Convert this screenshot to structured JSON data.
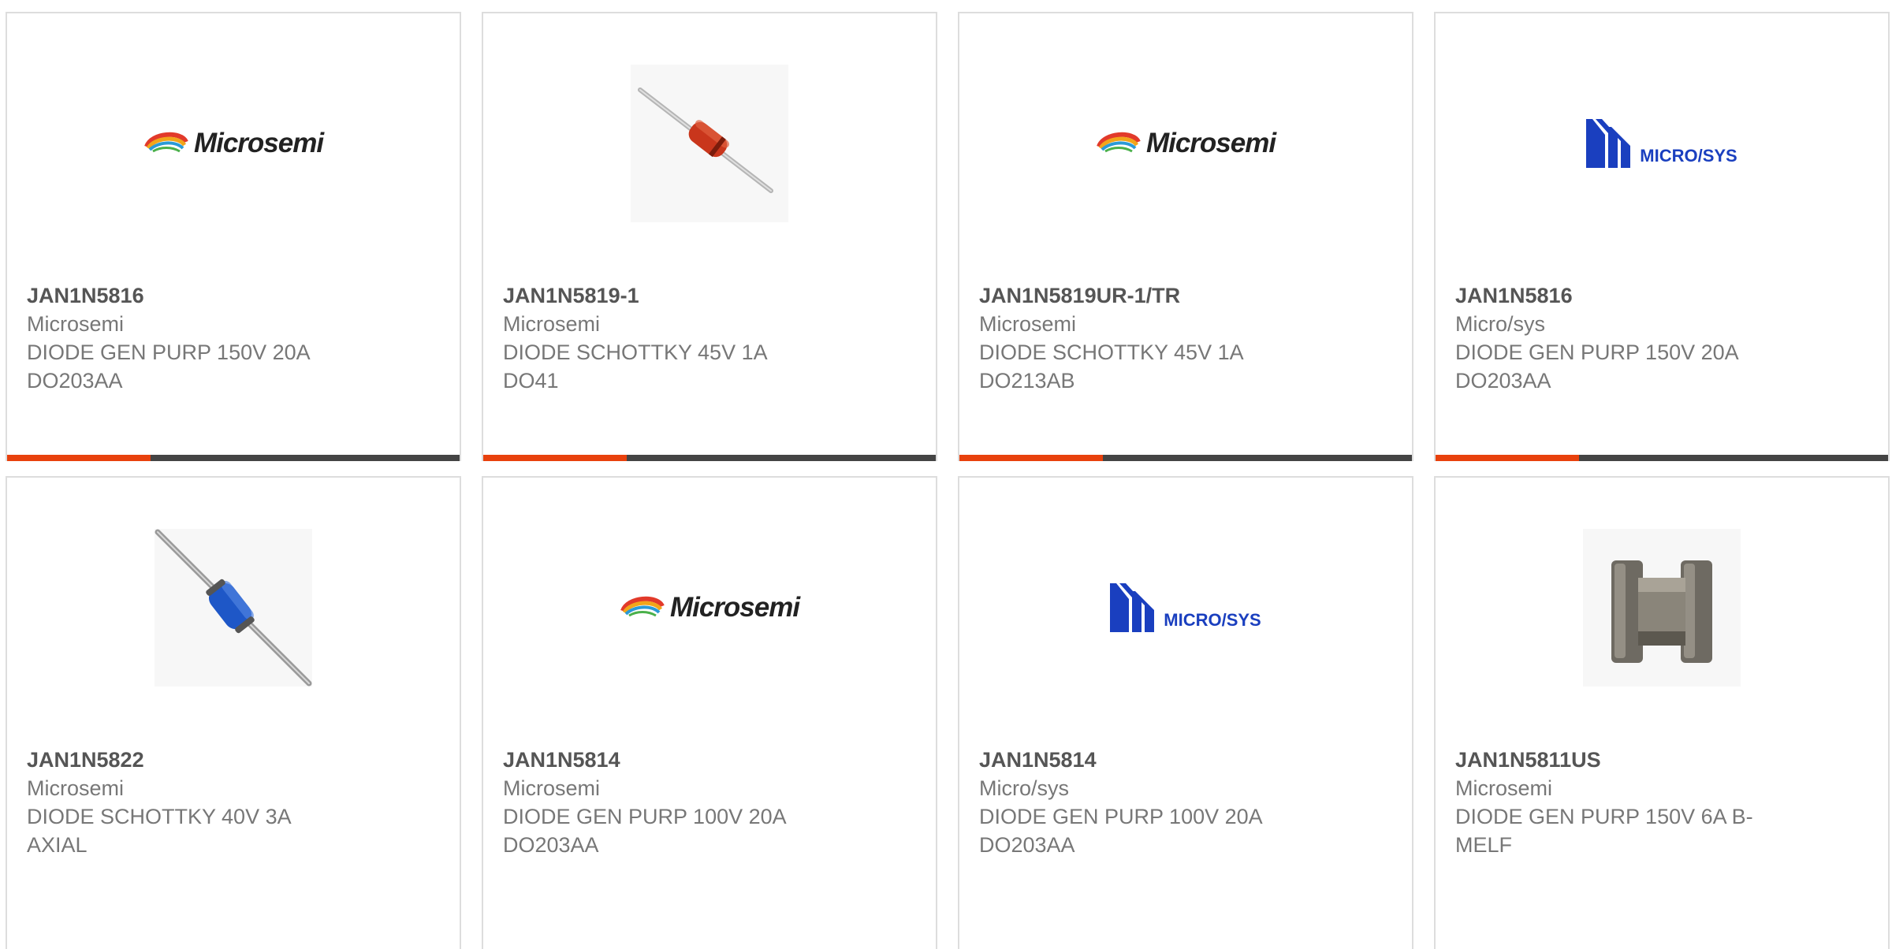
{
  "colors": {
    "accent_orange": "#e8410d",
    "accent_dark": "#444444",
    "card_border": "#dddddd",
    "part_number": "#555555",
    "text": "#777777",
    "microsys_blue": "#1a3fbf"
  },
  "products": [
    {
      "part_number": "JAN1N5816",
      "manufacturer": "Microsemi",
      "description": "DIODE GEN PURP 150V 20A DO203AA",
      "image": {
        "kind": "logo",
        "icon": "microsemi-logo-icon",
        "text": "Microsemi"
      }
    },
    {
      "part_number": "JAN1N5819-1",
      "manufacturer": "Microsemi",
      "description": "DIODE SCHOTTKY 45V 1A DO41",
      "image": {
        "kind": "photo",
        "icon": "axial-diode-red-icon"
      }
    },
    {
      "part_number": "JAN1N5819UR-1/TR",
      "manufacturer": "Microsemi",
      "description": "DIODE SCHOTTKY 45V 1A DO213AB",
      "image": {
        "kind": "logo",
        "icon": "microsemi-logo-icon",
        "text": "Microsemi"
      }
    },
    {
      "part_number": "JAN1N5816",
      "manufacturer": "Micro/sys",
      "description": "DIODE GEN PURP 150V 20A DO203AA",
      "image": {
        "kind": "logo",
        "icon": "microsys-logo-icon",
        "text": "MICRO/SYS"
      }
    },
    {
      "part_number": "JAN1N5822",
      "manufacturer": "Microsemi",
      "description": "DIODE SCHOTTKY 40V 3A AXIAL",
      "image": {
        "kind": "photo",
        "icon": "axial-diode-blue-icon"
      }
    },
    {
      "part_number": "JAN1N5814",
      "manufacturer": "Microsemi",
      "description": "DIODE GEN PURP 100V 20A DO203AA",
      "image": {
        "kind": "logo",
        "icon": "microsemi-logo-icon",
        "text": "Microsemi"
      }
    },
    {
      "part_number": "JAN1N5814",
      "manufacturer": "Micro/sys",
      "description": "DIODE GEN PURP 100V 20A DO203AA",
      "image": {
        "kind": "logo",
        "icon": "microsys-logo-icon",
        "text": "MICRO/SYS"
      }
    },
    {
      "part_number": "JAN1N5811US",
      "manufacturer": "Microsemi",
      "description": "DIODE GEN PURP 150V 6A B-MELF",
      "image": {
        "kind": "photo",
        "icon": "melf-diode-icon"
      }
    }
  ]
}
